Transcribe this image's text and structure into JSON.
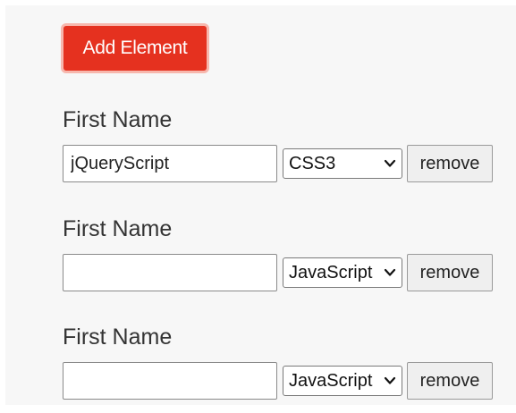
{
  "toolbar": {
    "add_label": "Add Element"
  },
  "rows": [
    {
      "label": "First Name",
      "input_value": "jQueryScript",
      "select_value": "CSS3",
      "remove_label": "remove"
    },
    {
      "label": "First Name",
      "input_value": "",
      "select_value": "JavaScript",
      "remove_label": "remove"
    },
    {
      "label": "First Name",
      "input_value": "",
      "select_value": "JavaScript",
      "remove_label": "remove"
    }
  ],
  "colors": {
    "accent": "#e5311f",
    "accent_border": "#f7b7ad",
    "panel_bg": "#f7f7f7"
  },
  "icons": {
    "select_arrow": "chevron-down-icon"
  }
}
